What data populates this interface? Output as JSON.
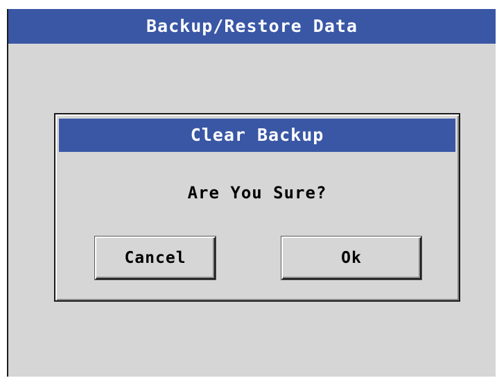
{
  "window": {
    "title": "Backup/Restore Data"
  },
  "dialog": {
    "title": "Clear Backup",
    "message": "Are You Sure?",
    "buttons": {
      "cancel": "Cancel",
      "ok": "Ok"
    }
  },
  "colors": {
    "title_bar": "#3a57a5",
    "background": "#d6d6d6",
    "title_text": "#ffffff",
    "body_text": "#000000"
  }
}
